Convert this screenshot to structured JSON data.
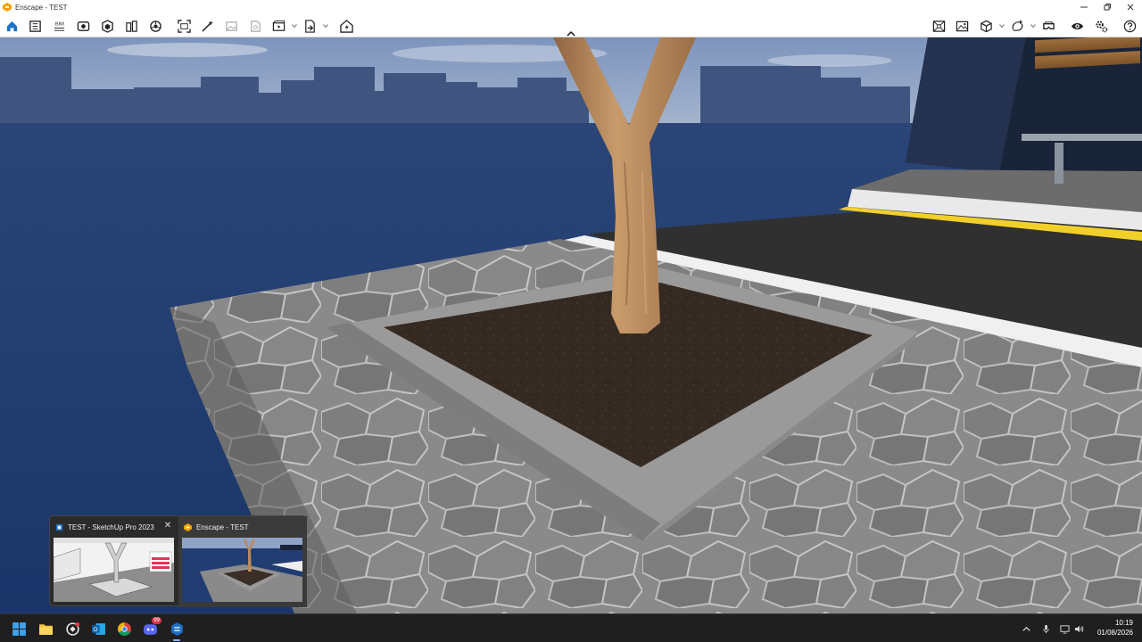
{
  "window": {
    "title": "Enscape - TEST",
    "icons": [
      "enscape-logo-icon",
      "minimize-icon",
      "maximize-icon",
      "close-icon"
    ]
  },
  "toolbar": {
    "left_tools": [
      "home-icon",
      "sidebar-icon",
      "bim-icon",
      "view-icon",
      "asset-library-icon",
      "material-icon",
      "atmosphere-icon",
      "screenshot-icon",
      "magic-icon",
      "image-icon",
      "panorama-icon",
      "video-editor-icon",
      "export-icon",
      "upload-icon"
    ],
    "right_tools": [
      "presentation-icon",
      "image-gallery-icon",
      "cube-icon",
      "sync-icon",
      "vr-headset-icon",
      "visibility-icon",
      "settings-icon",
      "help-icon"
    ],
    "colors": {
      "accent": "#1a73c7",
      "icon": "#222222"
    }
  },
  "viewport": {
    "colors": {
      "sky": "#8fa4c6",
      "ground": "#1f3a6e",
      "stone": "#8d8d8d",
      "soil": "#3a2e26",
      "tree": "#b88a5c",
      "asphalt": "#2f2f2f",
      "yellow_line": "#f2d02a"
    }
  },
  "taskbar_preview": {
    "windows": [
      {
        "title": "TEST - SketchUp Pro 2023",
        "close_label": "✕"
      },
      {
        "title": "Enscape - TEST"
      }
    ]
  },
  "taskbar": {
    "apps": [
      "start-icon",
      "file-explorer-icon",
      "app-icon",
      "outlook-icon",
      "chrome-icon",
      "discord-icon",
      "enscape-taskbar-icon"
    ],
    "notification_badge": "99",
    "tray": [
      "chevron-up-icon",
      "microphone-icon",
      "network-icon",
      "volume-icon"
    ],
    "time": "10:19",
    "date": "01/08/2026"
  }
}
